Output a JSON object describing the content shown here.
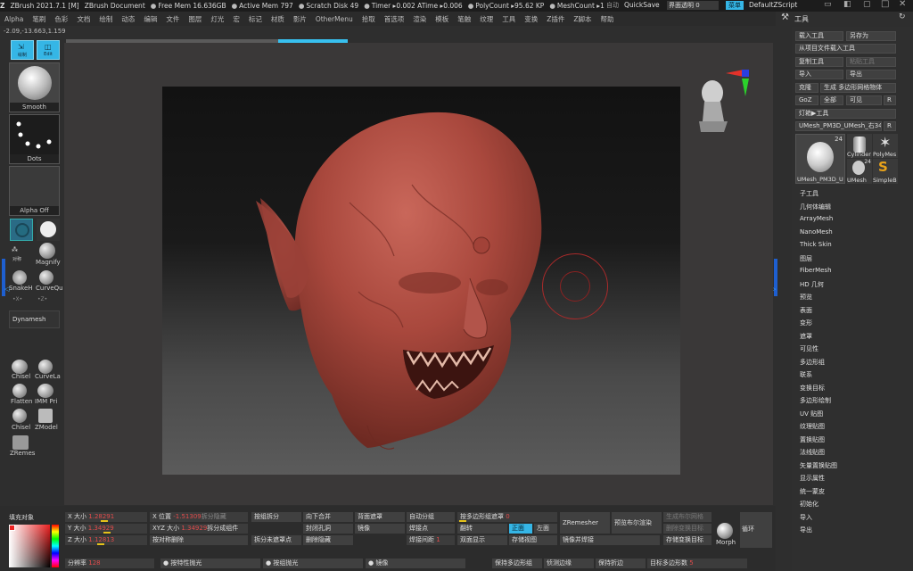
{
  "titlebar": {
    "app": "ZBrush 2021.7.1 [M]",
    "document": "ZBrush Document",
    "free_mem": "Free Mem 16.636GB",
    "active_mem": "Active Mem 797",
    "scratch": "Scratch Disk 49",
    "timer": "Timer ▸0.002 ATime ▸0.006",
    "polycount": "PolyCount ▸95.62 KP",
    "meshcount": "MeshCount ▸1",
    "autosave": "自动",
    "quicksave": "QuickSave",
    "transparency": "界面透明 0",
    "menu": "菜单",
    "zscript": "DefaultZScript"
  },
  "menubar": [
    "Alpha",
    "笔刷",
    "色彩",
    "文档",
    "绘制",
    "动态",
    "编辑",
    "文件",
    "图层",
    "灯光",
    "宏",
    "标记",
    "材质",
    "影片",
    "OtherMenu",
    "拾取",
    "首选项",
    "渲染",
    "模板",
    "笔触",
    "纹理",
    "工具",
    "变换",
    "Z插件",
    "Z脚本",
    "帮助"
  ],
  "coords": "-2.09,-13.663,1.159",
  "top_buttons": {
    "draw": "绘制",
    "edit": "Edit"
  },
  "left": {
    "smooth": "Smooth",
    "dots": "Dots",
    "alpha_off": "Alpha Off",
    "magnify": "Magnify",
    "snake": "SnakeH",
    "curve": "CurveQu",
    "sym1": "对称",
    "x_label": "•X•",
    "z_label": "•Z•",
    "dynamesh": "Dynamesh",
    "brushes": [
      {
        "name": "Chisel"
      },
      {
        "name": "CurveLa"
      },
      {
        "name": "Flatten"
      },
      {
        "name": "IMM Pri"
      },
      {
        "name": "Chisel"
      },
      {
        "name": "ZModel"
      },
      {
        "name": "ZRemes"
      }
    ]
  },
  "right": {
    "header": "工具",
    "buttons": [
      {
        "label": "载入工具"
      },
      {
        "label": "另存为"
      },
      {
        "label": "从项目文件载入工具"
      },
      {
        "label": "复制工具"
      },
      {
        "label": "粘贴工具"
      },
      {
        "label": "导入"
      },
      {
        "label": "导出"
      },
      {
        "label": "克隆"
      },
      {
        "label": "生成 多边形网格物体"
      },
      {
        "label": "GoZ"
      },
      {
        "label": "全部"
      },
      {
        "label": "可见"
      },
      {
        "label": "R"
      },
      {
        "label": "灯箱▶工具"
      },
      {
        "label": "UMesh_PM3D_UMesh_右348"
      },
      {
        "label": "R"
      }
    ],
    "thumbs": [
      {
        "label": "UMesh_PM3D_U",
        "count": "24"
      },
      {
        "label": "Cylinder"
      },
      {
        "label": "PolyMes"
      },
      {
        "label": "UMesh",
        "count": "24"
      },
      {
        "label": "SimpleB"
      }
    ],
    "menu_items": [
      "子工具",
      "几何体编辑",
      "ArrayMesh",
      "NanoMesh",
      "Thick Skin",
      "图层",
      "FiberMesh",
      "HD 几何",
      "预览",
      "表面",
      "变形",
      "遮罩",
      "可见性",
      "多边形组",
      "联系",
      "变换目标",
      "多边形绘制",
      "UV 贴图",
      "纹理贴图",
      "置换贴图",
      "法线贴图",
      "矢量置换贴图",
      "显示属性",
      "统一蒙皮",
      "初始化",
      "导入",
      "导出"
    ]
  },
  "bottom": {
    "fill": "填充对象",
    "x_size": "X 大小",
    "x_size_val": "1.28291",
    "y_size": "Y 大小",
    "y_size_val": "1.34929",
    "z_size": "Z 大小",
    "z_size_val": "1.12813",
    "x_pos": "X 位置",
    "x_pos_val": "-1.51309",
    "xyz_size": "XYZ 大小",
    "xyz_size_val": "1.34929",
    "split_hidden": "拆分隐藏",
    "split_to_parts": "拆分成组件",
    "symm_delete": "按对称删除",
    "group_split": "按组拆分",
    "split_unmasked": "拆分未遮罩点",
    "merge_down": "向下合并",
    "close_holes": "封闭孔洞",
    "delete_hidden": "删除隐藏",
    "mask_front": "背面遮罩",
    "mirror": "镜像",
    "auto_group": "自动分组",
    "weld_points": "焊接点",
    "weld_dist": "焊接间距",
    "weld_dist_val": "1",
    "poly_mask": "按多边形组遮罩",
    "poly_mask_val": "0",
    "flip": "翻转",
    "double": "双面显示",
    "front": "正面",
    "left": "左面",
    "save_view": "存储视图",
    "mirror_weld": "镜像并焊接",
    "zremesher": "ZRemesher",
    "preview_boolean": "预览布尔渲染",
    "gen_morph": "生成布尔网格",
    "del_morph": "删除变换目标",
    "store_morph": "存储变换目标",
    "morph": "Morph",
    "loop": "循环",
    "sub_res": "分辨率",
    "sub_res_val": "128",
    "polish_features": "按特性抛光",
    "polish_groups": "按组抛光",
    "mirror2": "镜像",
    "keep_groups": "保持多边形组",
    "detect_edges": "侦测边缘",
    "keep_creases": "保持折边",
    "target_poly": "目标多边形数",
    "target_poly_val": "5"
  }
}
